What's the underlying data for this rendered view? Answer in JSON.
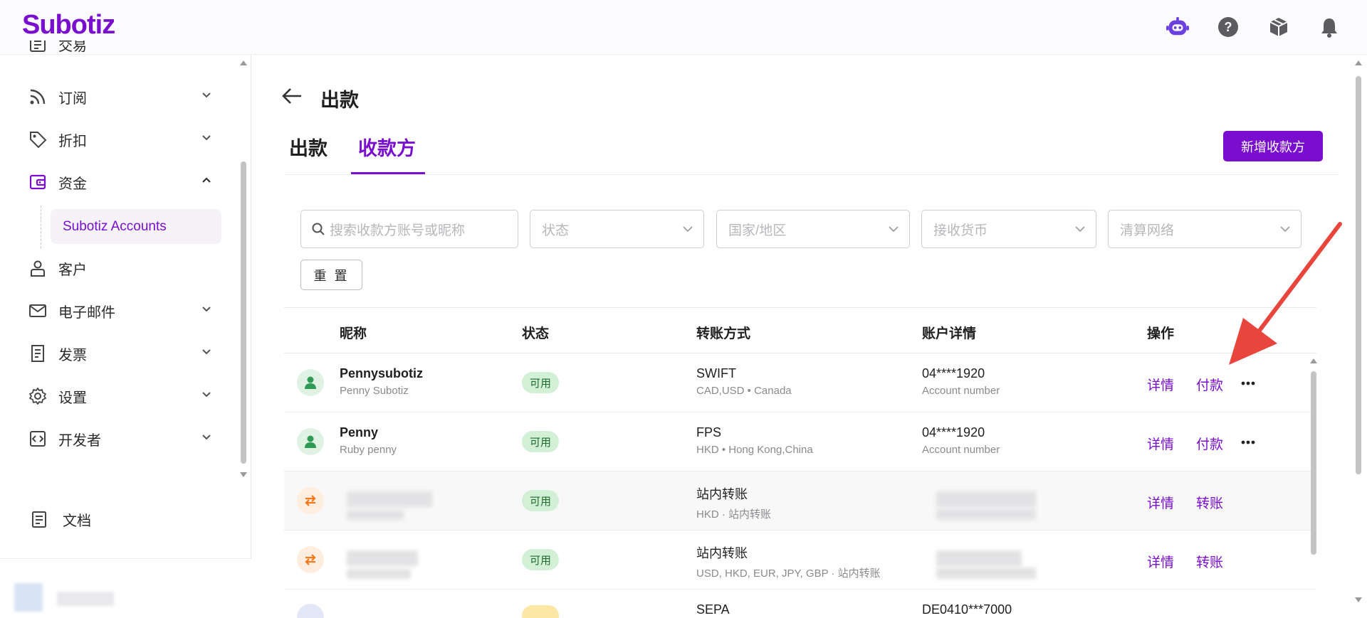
{
  "brand": {
    "logo_text": "Subotiz",
    "accent": "#7a0ecf"
  },
  "topbar": {
    "icons": [
      "assistant-bot-icon",
      "help-circle-icon",
      "package-box-icon",
      "notification-bell-icon"
    ]
  },
  "sidebar": {
    "items": [
      {
        "label": "交易",
        "icon": "transactions-icon",
        "expandable": true
      },
      {
        "label": "订阅",
        "icon": "rss-icon",
        "expandable": true
      },
      {
        "label": "折扣",
        "icon": "tag-icon",
        "expandable": true
      },
      {
        "label": "资金",
        "icon": "wallet-icon",
        "expandable": true,
        "expanded": true
      },
      {
        "label": "客户",
        "icon": "user-icon",
        "expandable": false
      },
      {
        "label": "电子邮件",
        "icon": "mail-icon",
        "expandable": true
      },
      {
        "label": "发票",
        "icon": "invoice-icon",
        "expandable": true
      },
      {
        "label": "设置",
        "icon": "gear-icon",
        "expandable": true
      },
      {
        "label": "开发者",
        "icon": "code-icon",
        "expandable": true
      }
    ],
    "sub_item": "Subotiz Accounts",
    "docs": "文档"
  },
  "page": {
    "title": "出款",
    "tabs": [
      {
        "label": "出款",
        "active": false
      },
      {
        "label": "收款方",
        "active": true
      }
    ],
    "add_button": "新增收款方"
  },
  "filters": {
    "search_placeholder": "搜索收款方账号或昵称",
    "status": "状态",
    "country": "国家/地区",
    "currency": "接收货币",
    "network": "清算网络",
    "reset": "重 置"
  },
  "table": {
    "headers": [
      "昵称",
      "状态",
      "转账方式",
      "账户详情",
      "操作"
    ],
    "rows": [
      {
        "name": "Pennysubotiz",
        "sub": "Penny Subotiz",
        "status": "可用",
        "method": "SWIFT",
        "method_sub": "CAD,USD • Canada",
        "account": "04****1920",
        "account_sub": "Account number",
        "action1": "详情",
        "action2": "付款"
      },
      {
        "name": "Penny",
        "sub": "Ruby penny",
        "status": "可用",
        "method": "FPS",
        "method_sub": "HKD • Hong Kong,China",
        "account": "04****1920",
        "account_sub": "Account number",
        "action1": "详情",
        "action2": "付款"
      },
      {
        "name": "",
        "sub": "",
        "status": "可用",
        "method": "站内转账",
        "method_sub": "HKD · 站内转账",
        "account": "",
        "account_sub": "",
        "action1": "详情",
        "action2": "转账"
      },
      {
        "name": "",
        "sub": "",
        "status": "可用",
        "method": "站内转账",
        "method_sub": "USD, HKD, EUR, JPY, GBP · 站内转账",
        "account": "",
        "account_sub": "",
        "action1": "详情",
        "action2": "转账"
      },
      {
        "name": "",
        "sub": "",
        "status": "",
        "method": "SEPA",
        "method_sub": "",
        "account": "DE0410***7000",
        "account_sub": "",
        "action1": "",
        "action2": ""
      }
    ]
  },
  "annotation": {
    "color": "#e8453c"
  }
}
